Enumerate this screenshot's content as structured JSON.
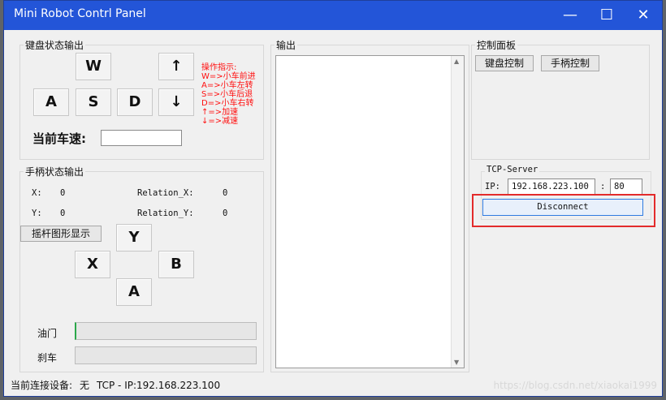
{
  "window": {
    "title": "Mini Robot Contrl Panel",
    "min": "—",
    "max": "☐",
    "close": "✕"
  },
  "keyboard": {
    "group_title": "键盘状态输出",
    "keys": {
      "w": "W",
      "a": "A",
      "s": "S",
      "d": "D",
      "up": "↑",
      "down": "↓"
    },
    "speed_label": "当前车速:"
  },
  "hints": [
    "操作指示:",
    "W=>小车前进",
    "A=>小车左转",
    "S=>小车后退",
    "D=>小车右转",
    "↑=>加速",
    "↓=>减速"
  ],
  "gamepad": {
    "group_title": "手柄状态输出",
    "x_label": "X:",
    "x_value": "0",
    "y_label": "Y:",
    "y_value": "0",
    "relx_label": "Relation_X:",
    "relx_value": "0",
    "rely_label": "Relation_Y:",
    "rely_value": "0",
    "joystick_button": "摇杆图形显示",
    "keys": {
      "y": "Y",
      "x": "X",
      "b": "B",
      "a": "A"
    },
    "throttle_label": "油门",
    "brake_label": "刹车"
  },
  "output": {
    "group_title": "输出"
  },
  "control": {
    "group_title": "控制面板",
    "keyboard_button": "键盘控制",
    "gamepad_button": "手柄控制"
  },
  "tcp": {
    "group_title": "TCP-Server",
    "ip_label": "IP:",
    "ip_value": "192.168.223.100",
    "port_sep": ":",
    "port_value": "80",
    "disconnect": "Disconnect"
  },
  "status": {
    "device_label": "当前连接设备:",
    "device_value": "无",
    "tcp_info": "TCP - IP:192.168.223.100"
  },
  "watermark": "https://blog.csdn.net/xiaokai1999"
}
